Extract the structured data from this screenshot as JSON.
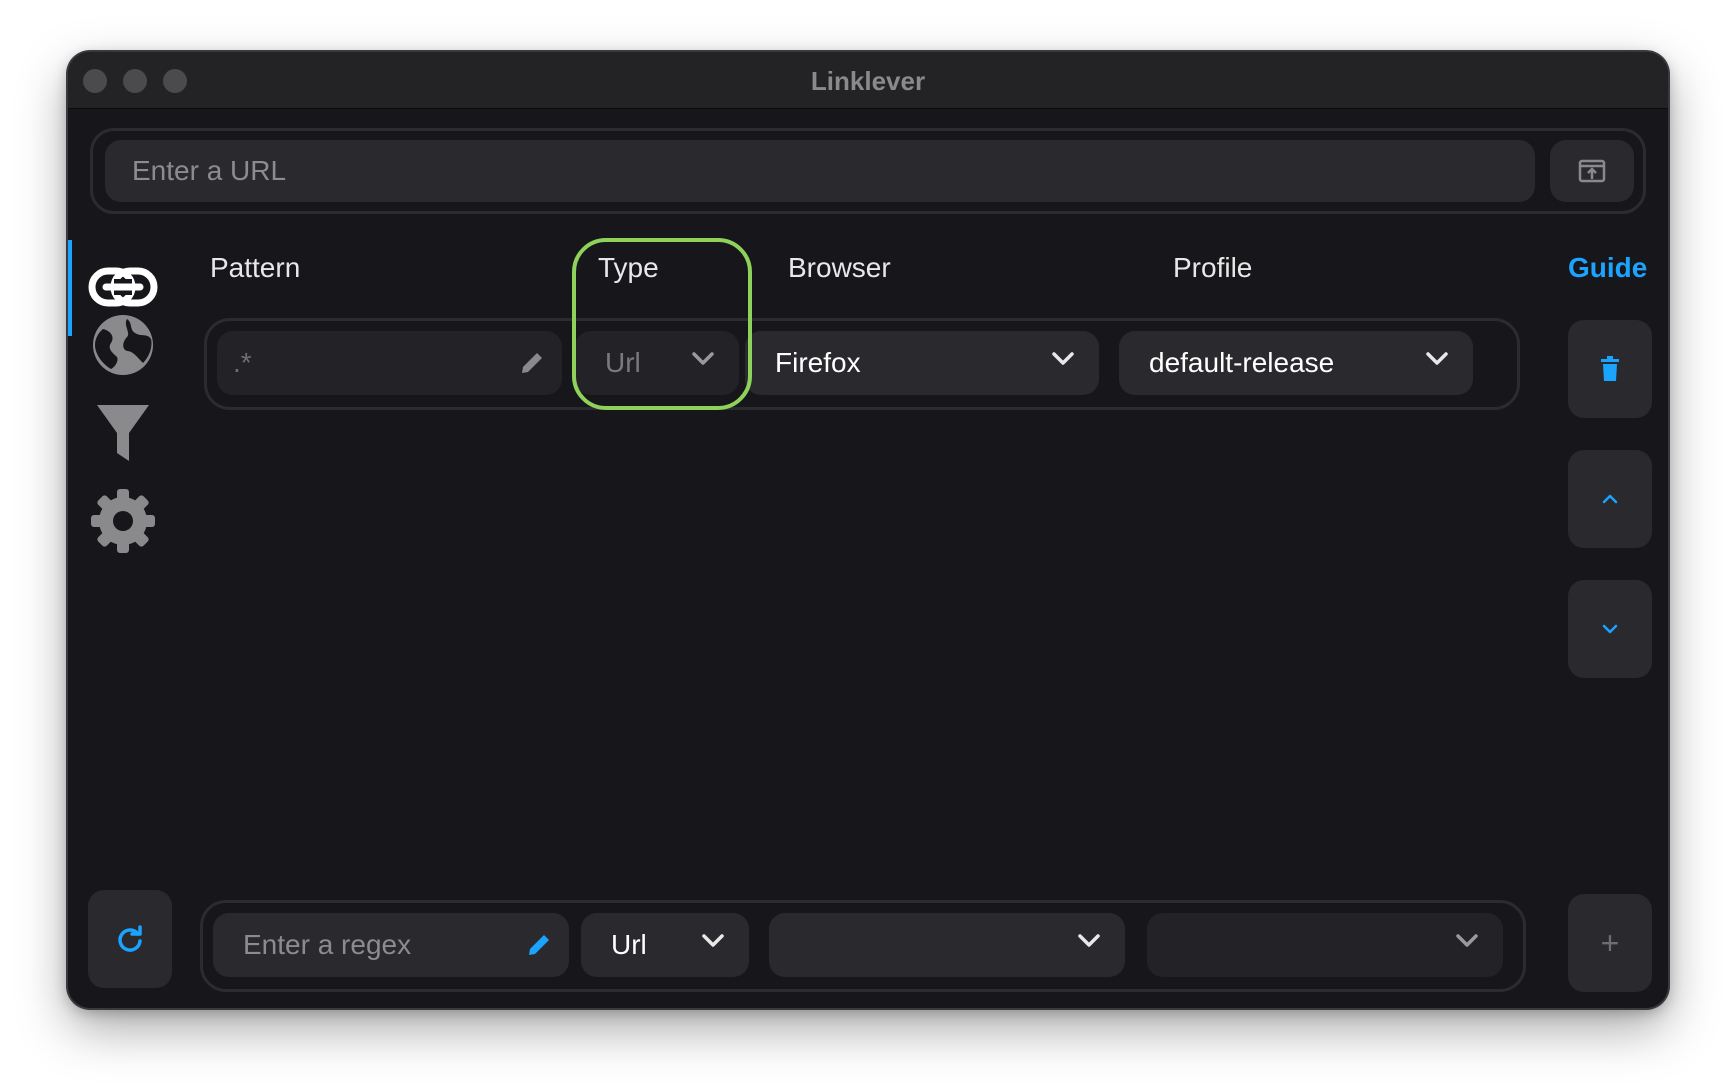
{
  "window": {
    "title": "Linklever"
  },
  "url_bar": {
    "placeholder": "Enter a URL"
  },
  "sidebar": {
    "items": [
      {
        "name": "rules",
        "icon": "link-icon",
        "active": true
      },
      {
        "name": "browsers",
        "icon": "globe-icon",
        "active": false
      },
      {
        "name": "filters",
        "icon": "filter-icon",
        "active": false
      },
      {
        "name": "settings",
        "icon": "gear-icon",
        "active": false
      }
    ]
  },
  "table": {
    "headers": {
      "pattern": "Pattern",
      "type": "Type",
      "browser": "Browser",
      "profile": "Profile"
    },
    "guide_label": "Guide",
    "rows": [
      {
        "pattern": ".*",
        "type": "Url",
        "browser": "Firefox",
        "profile": "default-release"
      }
    ]
  },
  "new_rule": {
    "pattern_placeholder": "Enter a regex",
    "type": "Url",
    "browser": "",
    "profile": ""
  },
  "buttons": {
    "add_label": "+"
  },
  "colors": {
    "accent": "#1aa3ff",
    "background": "#17171b",
    "highlight": "#8ed25c"
  }
}
